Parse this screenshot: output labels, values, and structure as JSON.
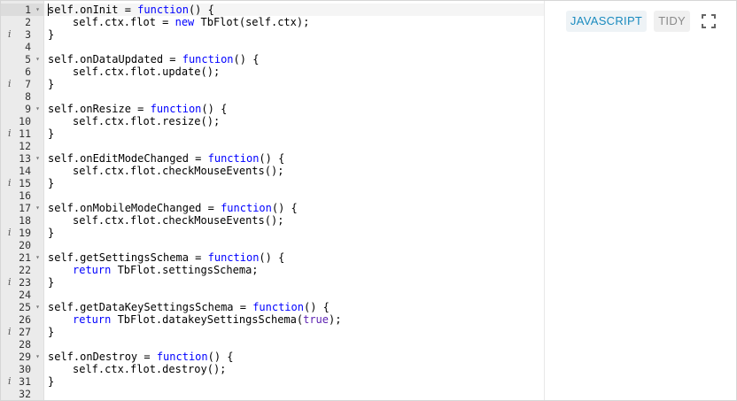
{
  "toolbar": {
    "mode_label": "JAVASCRIPT",
    "tidy_label": "TIDY",
    "fullscreen_icon": "fullscreen-icon"
  },
  "editor": {
    "active_line": 1,
    "lines": [
      {
        "n": "1",
        "fold": true,
        "info": false,
        "indent": 0,
        "tokens": [
          [
            "self.onInit = ",
            ""
          ],
          [
            "function",
            "kw"
          ],
          [
            "() {",
            ""
          ]
        ]
      },
      {
        "n": "2",
        "fold": false,
        "info": false,
        "indent": 1,
        "tokens": [
          [
            "self.ctx.flot = ",
            ""
          ],
          [
            "new",
            "kw"
          ],
          [
            " TbFlot(self.ctx);",
            ""
          ]
        ]
      },
      {
        "n": "3",
        "fold": false,
        "info": true,
        "indent": 0,
        "tokens": [
          [
            "}",
            ""
          ]
        ]
      },
      {
        "n": "4",
        "fold": false,
        "info": false,
        "indent": 0,
        "tokens": []
      },
      {
        "n": "5",
        "fold": true,
        "info": false,
        "indent": 0,
        "tokens": [
          [
            "self.onDataUpdated = ",
            ""
          ],
          [
            "function",
            "kw"
          ],
          [
            "() {",
            ""
          ]
        ]
      },
      {
        "n": "6",
        "fold": false,
        "info": false,
        "indent": 1,
        "tokens": [
          [
            "self.ctx.flot.update();",
            ""
          ]
        ]
      },
      {
        "n": "7",
        "fold": false,
        "info": true,
        "indent": 0,
        "tokens": [
          [
            "}",
            ""
          ]
        ]
      },
      {
        "n": "8",
        "fold": false,
        "info": false,
        "indent": 0,
        "tokens": []
      },
      {
        "n": "9",
        "fold": true,
        "info": false,
        "indent": 0,
        "tokens": [
          [
            "self.onResize = ",
            ""
          ],
          [
            "function",
            "kw"
          ],
          [
            "() {",
            ""
          ]
        ]
      },
      {
        "n": "10",
        "fold": false,
        "info": false,
        "indent": 1,
        "tokens": [
          [
            "self.ctx.flot.resize();",
            ""
          ]
        ]
      },
      {
        "n": "11",
        "fold": false,
        "info": true,
        "indent": 0,
        "tokens": [
          [
            "}",
            ""
          ]
        ]
      },
      {
        "n": "12",
        "fold": false,
        "info": false,
        "indent": 0,
        "tokens": []
      },
      {
        "n": "13",
        "fold": true,
        "info": false,
        "indent": 0,
        "tokens": [
          [
            "self.onEditModeChanged = ",
            ""
          ],
          [
            "function",
            "kw"
          ],
          [
            "() {",
            ""
          ]
        ]
      },
      {
        "n": "14",
        "fold": false,
        "info": false,
        "indent": 1,
        "tokens": [
          [
            "self.ctx.flot.checkMouseEvents();",
            ""
          ]
        ]
      },
      {
        "n": "15",
        "fold": false,
        "info": true,
        "indent": 0,
        "tokens": [
          [
            "}",
            ""
          ]
        ]
      },
      {
        "n": "16",
        "fold": false,
        "info": false,
        "indent": 0,
        "tokens": []
      },
      {
        "n": "17",
        "fold": true,
        "info": false,
        "indent": 0,
        "tokens": [
          [
            "self.onMobileModeChanged = ",
            ""
          ],
          [
            "function",
            "kw"
          ],
          [
            "() {",
            ""
          ]
        ]
      },
      {
        "n": "18",
        "fold": false,
        "info": false,
        "indent": 1,
        "tokens": [
          [
            "self.ctx.flot.checkMouseEvents();",
            ""
          ]
        ]
      },
      {
        "n": "19",
        "fold": false,
        "info": true,
        "indent": 0,
        "tokens": [
          [
            "}",
            ""
          ]
        ]
      },
      {
        "n": "20",
        "fold": false,
        "info": false,
        "indent": 0,
        "tokens": []
      },
      {
        "n": "21",
        "fold": true,
        "info": false,
        "indent": 0,
        "tokens": [
          [
            "self.getSettingsSchema = ",
            ""
          ],
          [
            "function",
            "kw"
          ],
          [
            "() {",
            ""
          ]
        ]
      },
      {
        "n": "22",
        "fold": false,
        "info": false,
        "indent": 1,
        "tokens": [
          [
            "return",
            "kw"
          ],
          [
            " TbFlot.settingsSchema;",
            ""
          ]
        ]
      },
      {
        "n": "23",
        "fold": false,
        "info": true,
        "indent": 0,
        "tokens": [
          [
            "}",
            ""
          ]
        ]
      },
      {
        "n": "24",
        "fold": false,
        "info": false,
        "indent": 0,
        "tokens": []
      },
      {
        "n": "25",
        "fold": true,
        "info": false,
        "indent": 0,
        "tokens": [
          [
            "self.getDataKeySettingsSchema = ",
            ""
          ],
          [
            "function",
            "kw"
          ],
          [
            "() {",
            ""
          ]
        ]
      },
      {
        "n": "26",
        "fold": false,
        "info": false,
        "indent": 1,
        "tokens": [
          [
            "return",
            "kw"
          ],
          [
            " TbFlot.datakeySettingsSchema(",
            ""
          ],
          [
            "true",
            "cst"
          ],
          [
            ");",
            ""
          ]
        ]
      },
      {
        "n": "27",
        "fold": false,
        "info": true,
        "indent": 0,
        "tokens": [
          [
            "}",
            ""
          ]
        ]
      },
      {
        "n": "28",
        "fold": false,
        "info": false,
        "indent": 0,
        "tokens": []
      },
      {
        "n": "29",
        "fold": true,
        "info": false,
        "indent": 0,
        "tokens": [
          [
            "self.onDestroy = ",
            ""
          ],
          [
            "function",
            "kw"
          ],
          [
            "() {",
            ""
          ]
        ]
      },
      {
        "n": "30",
        "fold": false,
        "info": false,
        "indent": 1,
        "tokens": [
          [
            "self.ctx.flot.destroy();",
            ""
          ]
        ]
      },
      {
        "n": "31",
        "fold": false,
        "info": true,
        "indent": 0,
        "tokens": [
          [
            "}",
            ""
          ]
        ]
      },
      {
        "n": "32",
        "fold": false,
        "info": false,
        "indent": 0,
        "tokens": []
      }
    ]
  }
}
